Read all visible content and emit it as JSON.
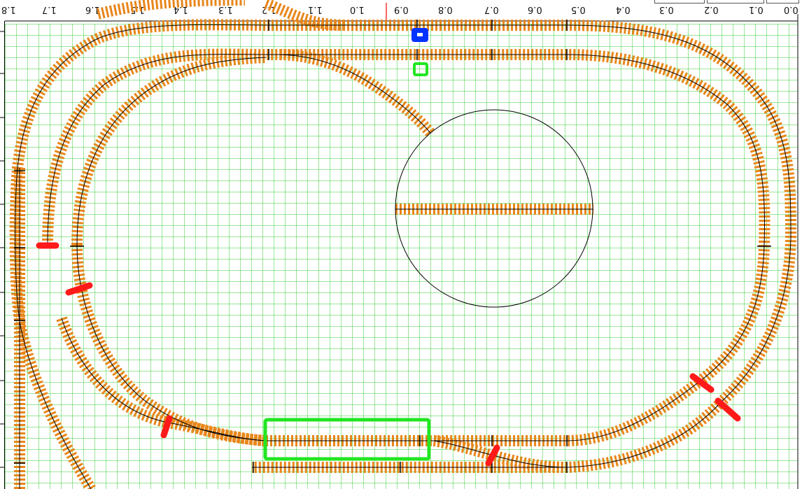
{
  "ruler": {
    "labels": [
      "1.8",
      "1.7",
      "1.6",
      "1.5",
      "1.4",
      "1.3",
      "1.2",
      "1.1",
      "1.0",
      "0.9",
      "0.8",
      "0.7",
      "0.6",
      "0.5",
      "0.4",
      "0.3",
      "0.2",
      "0.1",
      "0.0"
    ]
  },
  "colors": {
    "grid": "#33cc33",
    "track_ties": "#e8861a",
    "rail": "#000000",
    "signal": "#ff1a1a",
    "platform": "#22e622",
    "marker_blue": "#0033ff",
    "cursor_line": "#ff3030"
  },
  "icons": {
    "turntable": "turntable-icon",
    "signal": "signal-marker-icon",
    "blue_marker": "selected-object-icon",
    "green_marker": "waypoint-icon"
  }
}
